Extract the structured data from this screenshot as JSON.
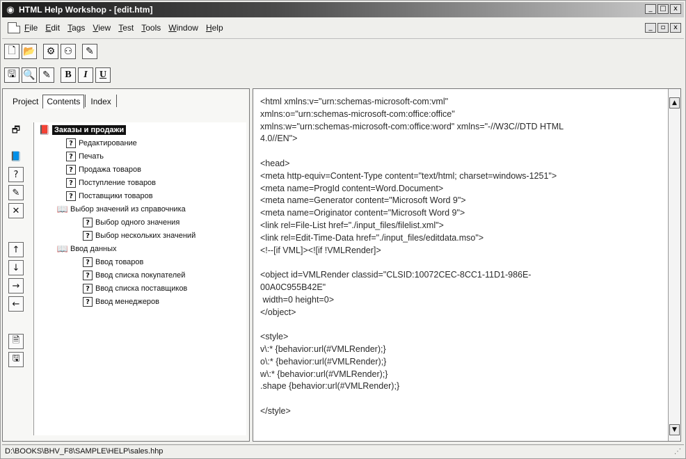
{
  "window": {
    "title": "HTML Help Workshop - [edit.htm]",
    "controls": {
      "minimize": "_",
      "maximize": "□",
      "close": "x",
      "restore": "▫"
    }
  },
  "menu": [
    "File",
    "Edit",
    "Tags",
    "View",
    "Test",
    "Tools",
    "Window",
    "Help"
  ],
  "toolbar1": [
    {
      "name": "new-icon",
      "glyph": "🗋"
    },
    {
      "name": "open-icon",
      "glyph": "📂"
    },
    {
      "name": "compile-icon",
      "glyph": "⚙"
    },
    {
      "name": "view-compiled-icon",
      "glyph": "⚇"
    },
    {
      "name": "display-topic-icon",
      "glyph": "✎"
    }
  ],
  "toolbar2": {
    "save": "🖫",
    "find": "🔍",
    "tag": "✎",
    "bold": "B",
    "italic": "I",
    "underline": "U"
  },
  "left_pane": {
    "tabs": [
      "Project",
      "Contents",
      "Index"
    ],
    "side_tools": [
      {
        "name": "contents-properties-icon",
        "glyph": "🗗"
      },
      {
        "name": "insert-heading-icon",
        "glyph": "📘"
      },
      {
        "name": "insert-page-icon",
        "glyph": "?"
      },
      {
        "name": "edit-selection-icon",
        "glyph": "✎"
      },
      {
        "name": "delete-selection-icon",
        "glyph": "✕"
      },
      {
        "name": "move-up-icon",
        "glyph": "↑"
      },
      {
        "name": "move-down-icon",
        "glyph": "↓"
      },
      {
        "name": "move-right-icon",
        "glyph": "→"
      },
      {
        "name": "move-left-icon",
        "glyph": "←"
      },
      {
        "name": "view-html-source-icon",
        "glyph": "🗎"
      },
      {
        "name": "save-file-icon",
        "glyph": "🖫"
      }
    ],
    "tree": [
      {
        "label": "Заказы и продажи",
        "type": "book",
        "level": 0,
        "selected": true
      },
      {
        "label": "Редактирование",
        "type": "page",
        "level": 1
      },
      {
        "label": "Печать",
        "type": "page",
        "level": 1
      },
      {
        "label": "Продажа товаров",
        "type": "page",
        "level": 1
      },
      {
        "label": "Поступление товаров",
        "type": "page",
        "level": 1
      },
      {
        "label": "Поставщики товаров",
        "type": "page",
        "level": 1
      },
      {
        "label": "Выбор значений из справочника",
        "type": "book",
        "level": 0.5
      },
      {
        "label": "Выбор одного значения",
        "type": "page",
        "level": 2
      },
      {
        "label": "Выбор нескольких значений",
        "type": "page",
        "level": 2
      },
      {
        "label": "Ввод данных",
        "type": "book",
        "level": 0.5
      },
      {
        "label": "Ввод товаров",
        "type": "page",
        "level": 2
      },
      {
        "label": "Ввод списка покупателей",
        "type": "page",
        "level": 2
      },
      {
        "label": "Ввод списка поставщиков",
        "type": "page",
        "level": 2
      },
      {
        "label": "Ввод менеджеров",
        "type": "page",
        "level": 2
      }
    ]
  },
  "editor": {
    "lines": [
      "<html xmlns:v=\"urn:schemas-microsoft-com:vml\"",
      "xmlns:o=\"urn:schemas-microsoft-com:office:office\"",
      "xmlns:w=\"urn:schemas-microsoft-com:office:word\" xmlns=\"-//W3C//DTD HTML",
      "4.0//EN\">",
      "",
      "<head>",
      "<meta http-equiv=Content-Type content=\"text/html; charset=windows-1251\">",
      "<meta name=ProgId content=Word.Document>",
      "<meta name=Generator content=\"Microsoft Word 9\">",
      "<meta name=Originator content=\"Microsoft Word 9\">",
      "<link rel=File-List href=\"./input_files/filelist.xml\">",
      "<link rel=Edit-Time-Data href=\"./input_files/editdata.mso\">",
      "<!--[if VML]><![if !VMLRender]>",
      "",
      "<object id=VMLRender classid=\"CLSID:10072CEC-8CC1-11D1-986E-",
      "00A0C955B42E\"",
      " width=0 height=0>",
      "</object>",
      "",
      "<style>",
      "v\\:* {behavior:url(#VMLRender);}",
      "o\\:* {behavior:url(#VMLRender);}",
      "w\\:* {behavior:url(#VMLRender);}",
      ".shape {behavior:url(#VMLRender);}",
      "",
      "</style>"
    ]
  },
  "status": {
    "path": "D:\\BOOKS\\BHV_F8\\SAMPLE\\HELP\\sales.hhp",
    "grip": "⋰"
  }
}
